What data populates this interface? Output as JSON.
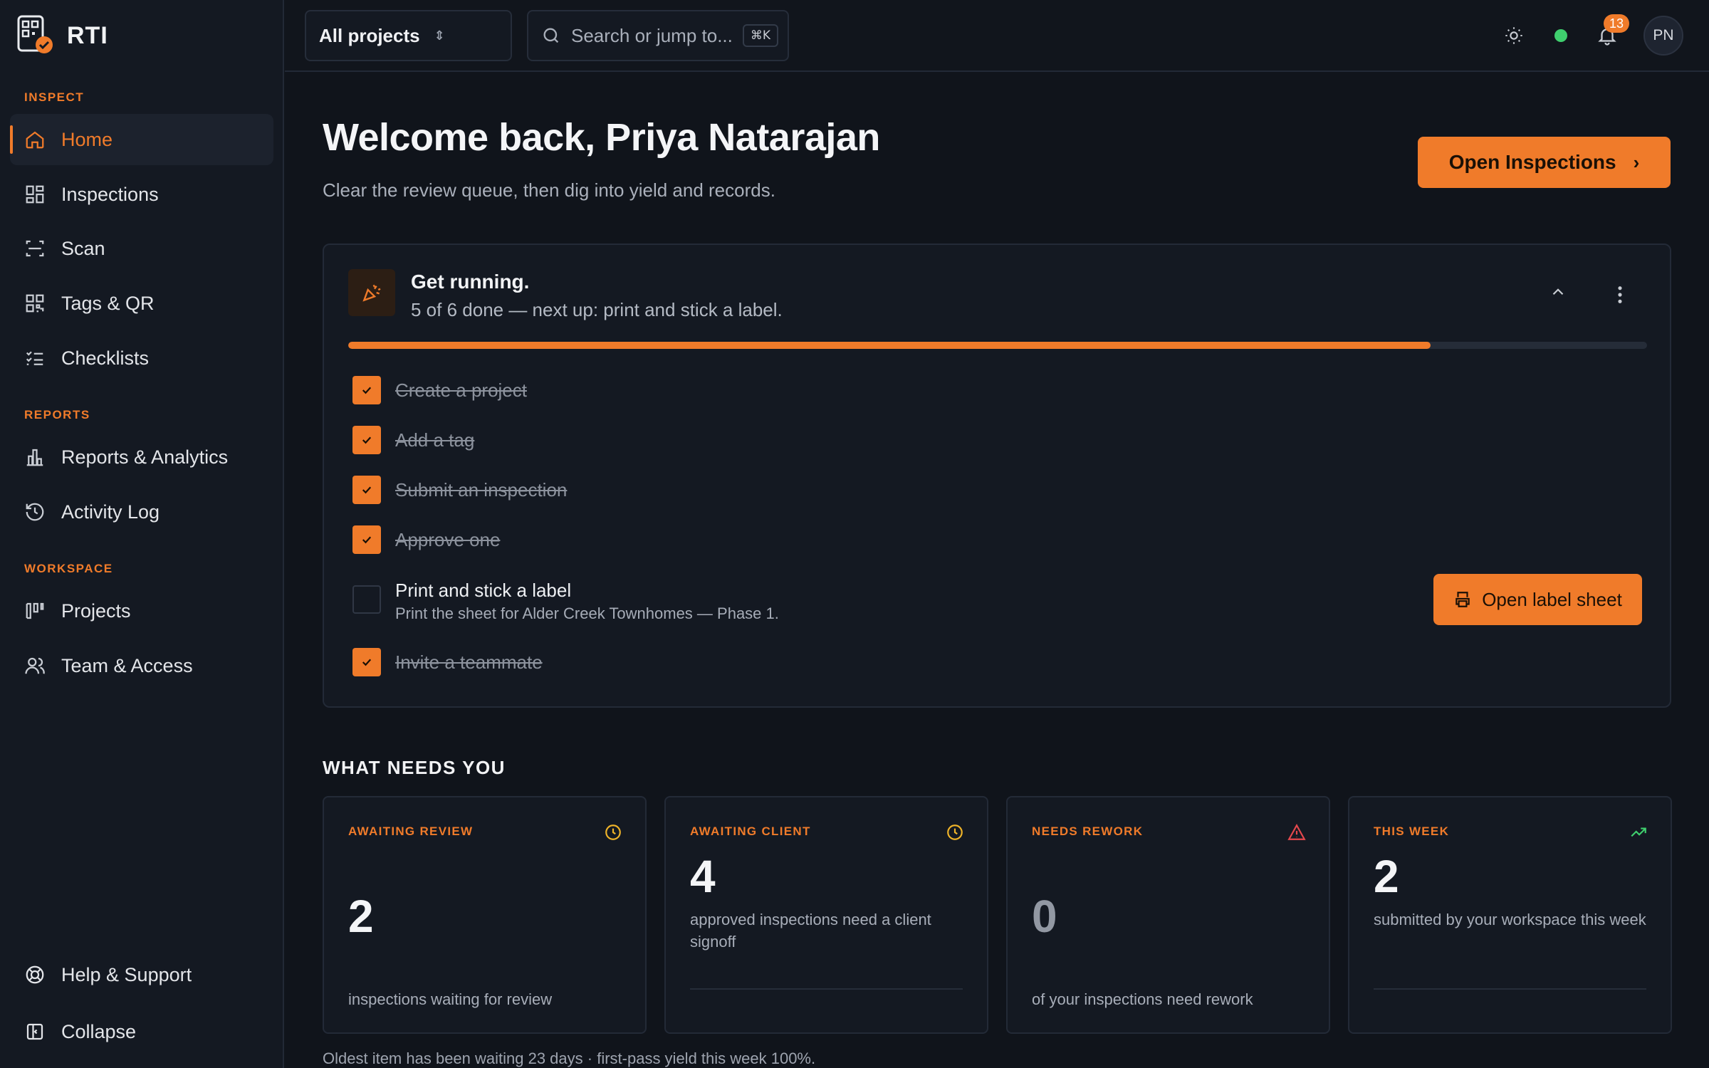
{
  "app": {
    "name": "RTI"
  },
  "sidebar": {
    "sections": {
      "inspect": "INSPECT",
      "reports": "REPORTS",
      "workspace": "WORKSPACE"
    },
    "items": [
      {
        "label": "Home",
        "icon": "home-icon",
        "active": true
      },
      {
        "label": "Inspections",
        "icon": "grid-icon"
      },
      {
        "label": "Scan",
        "icon": "scan-icon"
      },
      {
        "label": "Tags & QR",
        "icon": "qr-icon"
      },
      {
        "label": "Checklists",
        "icon": "checklist-icon"
      },
      {
        "label": "Reports & Analytics",
        "icon": "bar-chart-icon"
      },
      {
        "label": "Activity Log",
        "icon": "history-icon"
      },
      {
        "label": "Projects",
        "icon": "kanban-icon"
      },
      {
        "label": "Team & Access",
        "icon": "users-icon"
      }
    ],
    "footer": {
      "help": "Help & Support",
      "collapse": "Collapse"
    }
  },
  "topbar": {
    "project_select": "All projects",
    "search_placeholder": "Search or jump to...",
    "search_shortcut": "⌘K",
    "notifications_count": "13",
    "avatar_initials": "PN",
    "status_color": "#3fcf6e"
  },
  "main": {
    "title": "Welcome back, Priya Natarajan",
    "subtitle": "Clear the review queue, then dig into yield and records.",
    "primary_button": "Open Inspections"
  },
  "onboarding": {
    "title": "Get running.",
    "subtitle": "5 of 6 done — next up: print and stick a label.",
    "progress": 0.8333,
    "tasks": [
      {
        "label": "Create a project",
        "done": true
      },
      {
        "label": "Add a tag",
        "done": true
      },
      {
        "label": "Submit an inspection",
        "done": true
      },
      {
        "label": "Approve one",
        "done": true
      },
      {
        "label": "Print and stick a label",
        "done": false,
        "description": "Print the sheet for Alder Creek Townhomes — Phase 1."
      },
      {
        "label": "Invite a teammate",
        "done": true
      }
    ],
    "label_button": "Open label sheet"
  },
  "needs": {
    "heading": "WHAT NEEDS YOU",
    "cards": [
      {
        "label": "AWAITING REVIEW",
        "icon": "clock-icon",
        "value": "2",
        "description": "inspections waiting for review"
      },
      {
        "label": "AWAITING CLIENT",
        "icon": "clock-icon",
        "value": "4",
        "description": "approved inspections need a client signoff"
      },
      {
        "label": "NEEDS REWORK",
        "icon": "warning-icon",
        "value": "0",
        "description": "of your inspections need rework"
      },
      {
        "label": "THIS WEEK",
        "icon": "trending-up-icon",
        "value": "2",
        "description": "submitted by your workspace this week"
      }
    ],
    "footnote": "Oldest item has been waiting 23 days · first-pass yield this week 100%."
  },
  "colors": {
    "accent": "#f07b2a",
    "background": "#10141b",
    "surface": "#141922",
    "success": "#3fcf6e",
    "danger": "#e5484d"
  }
}
